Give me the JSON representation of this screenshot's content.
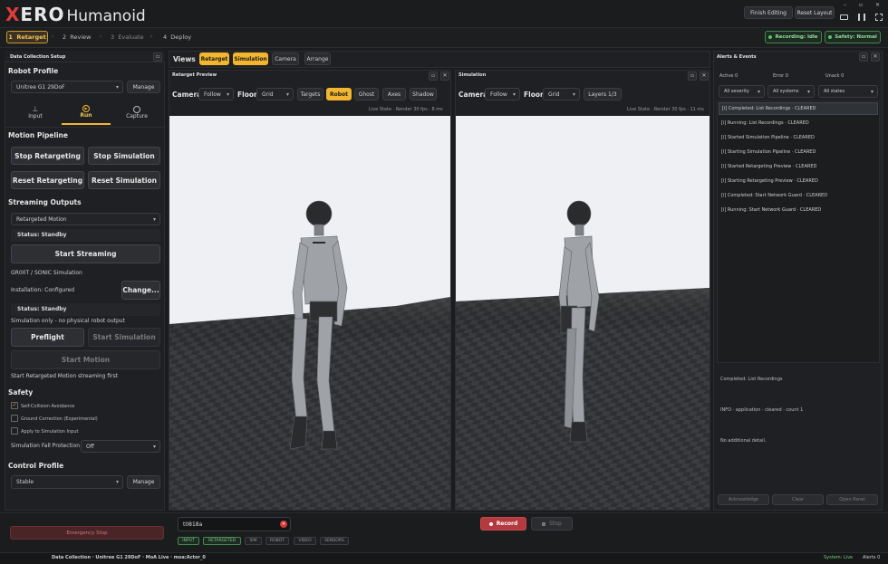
{
  "app": {
    "logo_x": "X",
    "logo_rest": "ERO",
    "subtitle": "Humanoid",
    "finish_editing": "Finish Editing",
    "reset_layout": "Reset Layout",
    "min_glyph": "–",
    "max_glyph": "▫",
    "close_glyph": "✕"
  },
  "steps": [
    {
      "num": "1",
      "label": "Retarget"
    },
    {
      "num": "2",
      "label": "Review"
    },
    {
      "num": "3",
      "label": "Evaluate"
    },
    {
      "num": "4",
      "label": "Deploy"
    }
  ],
  "status": {
    "recording": "Recording: Idle",
    "safety": "Safety: Normal",
    "color_ok": "#58c46a"
  },
  "left": {
    "title": "Data Collection Setup",
    "robot_profile": "Robot Profile",
    "robot_value": "Unitree G1 29DoF",
    "manage": "Manage",
    "tabs": [
      {
        "label": "Input"
      },
      {
        "label": "Run"
      },
      {
        "label": "Capture"
      }
    ],
    "motion_pipeline": "Motion Pipeline",
    "stop_retargeting": "Stop Retargeting",
    "stop_simulation": "Stop Simulation",
    "reset_retargeting": "Reset Retargeting",
    "reset_simulation": "Reset Simulation",
    "streaming_outputs": "Streaming Outputs",
    "stream_value": "Retargeted Motion",
    "status_standby": "Status: Standby",
    "start_streaming": "Start Streaming",
    "sim_name": "GR00T / SONIC Simulation",
    "installation": "Installation: Configured",
    "change": "Change...",
    "status_standby2": "Status: Standby",
    "sim_only": "Simulation only - no physical robot output",
    "preflight": "Preflight",
    "start_simulation": "Start Simulation",
    "start_motion": "Start Motion",
    "hint": "Start Retargeted Motion streaming first",
    "safety": "Safety",
    "checks": [
      {
        "label": "Self-Collision Avoidance",
        "checked": true
      },
      {
        "label": "Ground Correction (Experimental)",
        "checked": false
      },
      {
        "label": "Apply to Simulation Input",
        "checked": false
      }
    ],
    "fall_label": "Simulation Fall Protection",
    "fall_value": "Off",
    "control_profile": "Control Profile",
    "control_value": "Stable",
    "manage2": "Manage",
    "emergency": "Emergency Stop"
  },
  "views": {
    "label": "Views",
    "buttons": [
      {
        "label": "Retarget",
        "on": true
      },
      {
        "label": "Simulation",
        "on": true
      },
      {
        "label": "Camera",
        "on": false
      },
      {
        "label": "Arrange",
        "on": false
      }
    ]
  },
  "retarget_preview": {
    "title": "Retarget Preview",
    "camera": "Camera",
    "camera_value": "Follow",
    "floor": "Floor",
    "floor_value": "Grid",
    "toggles": [
      {
        "label": "Targets",
        "on": false
      },
      {
        "label": "Robot",
        "on": true
      },
      {
        "label": "Ghost",
        "on": false
      },
      {
        "label": "Axes",
        "on": false
      },
      {
        "label": "Shadow",
        "on": false
      }
    ],
    "live": "Live State · Render 30 fps · 8 ms"
  },
  "simulation": {
    "title": "Simulation",
    "camera": "Camera",
    "camera_value": "Follow",
    "floor": "Floor",
    "floor_value": "Grid",
    "layers": "Layers 1/3",
    "live": "Live State · Render 30 fps · 11 ms"
  },
  "alerts": {
    "title": "Alerts & Events",
    "active": "Active 0",
    "error": "Error 0",
    "unack": "Unack 0",
    "f1": "All severity",
    "f2": "All systems",
    "f3": "All states",
    "items": [
      "[i] Completed: List Recordings · CLEARED",
      "[i] Running: List Recordings · CLEARED",
      "[i] Started Simulation Pipeline · CLEARED",
      "[i] Starting Simulation Pipeline · CLEARED",
      "[i] Started Retargeting Preview · CLEARED",
      "[i] Starting Retargeting Preview · CLEARED",
      "[i] Completed: Start Network Guard · CLEARED",
      "[i] Running: Start Network Guard · CLEARED"
    ],
    "detail_title": "Completed: List Recordings",
    "detail_info": "INFO · application · cleared · count 1",
    "detail_more": "No additional detail.",
    "acknowledge": "Acknowledge",
    "clear": "Clear",
    "open_panel": "Open Panel"
  },
  "bottom": {
    "take": "t0818a",
    "record": "Record",
    "stop": "Stop",
    "tags": [
      {
        "label": "INPUT",
        "on": true
      },
      {
        "label": "RETARGETED",
        "on": true
      },
      {
        "label": "SIM",
        "on": false
      },
      {
        "label": "ROBOT",
        "on": false
      },
      {
        "label": "VIDEO",
        "on": false
      },
      {
        "label": "SENSORS",
        "on": false
      }
    ]
  },
  "statusbar": {
    "left": "Data Collection · Unitree G1 29DoF · MoA Live · moa:Actor_0",
    "system": "System: Live",
    "alerts": "Alerts 0"
  }
}
